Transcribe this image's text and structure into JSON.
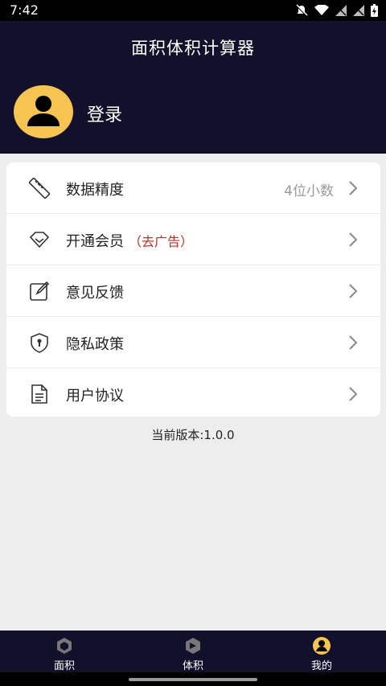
{
  "status": {
    "time": "7:42"
  },
  "header": {
    "title": "面积体积计算器",
    "login_label": "登录"
  },
  "menu": [
    {
      "icon": "ruler-icon",
      "label": "数据精度",
      "value": "4位小数",
      "promo": ""
    },
    {
      "icon": "diamond-icon",
      "label": "开通会员",
      "value": "",
      "promo": "（去广告）"
    },
    {
      "icon": "edit-icon",
      "label": "意见反馈",
      "value": "",
      "promo": ""
    },
    {
      "icon": "shield-icon",
      "label": "隐私政策",
      "value": "",
      "promo": ""
    },
    {
      "icon": "document-icon",
      "label": "用户协议",
      "value": "",
      "promo": ""
    }
  ],
  "version": "当前版本:1.0.0",
  "tabs": [
    {
      "label": "面积",
      "active": false
    },
    {
      "label": "体积",
      "active": false
    },
    {
      "label": "我的",
      "active": true
    }
  ],
  "colors": {
    "header_bg": "#12102a",
    "accent": "#f5c451",
    "promo": "#d0281f"
  }
}
